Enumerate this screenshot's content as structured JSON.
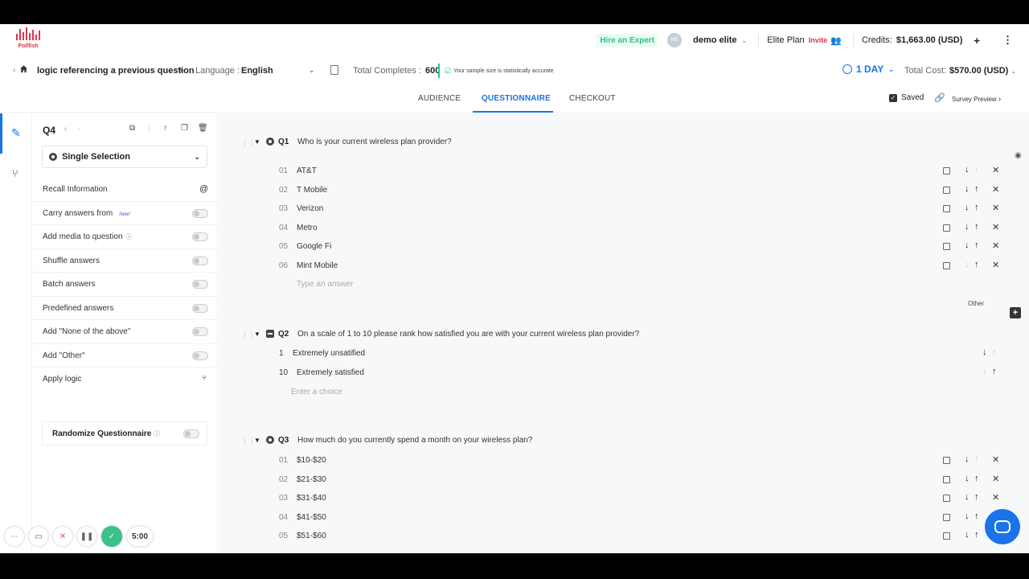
{
  "brand": {
    "name": "Pollfish",
    "color": "#e0344a"
  },
  "topbar": {
    "hire_expert": "Hire an Expert",
    "avatar_initials": "ME",
    "user_name": "demo elite",
    "plan": "Elite Plan",
    "invite": "Invite",
    "credits_label": "Credits:",
    "credits_value": "$1,663.00 (USD)",
    "plus": "+",
    "more": "⋮"
  },
  "survey_bar": {
    "title": "logic referencing a previous question",
    "language_label": "Language :",
    "language_value": "English",
    "total_completes_label": "Total Completes :",
    "total_completes_value": "600",
    "sample_note": "Your sample size is statistically accurate",
    "duration": "1 DAY",
    "total_cost_label": "Total Cost:",
    "total_cost_value": "$570.00 (USD)"
  },
  "tabs": [
    "AUDIENCE",
    "QUESTIONNAIRE",
    "CHECKOUT"
  ],
  "active_tab": "QUESTIONNAIRE",
  "saved_label": "Saved",
  "survey_preview": "Survey Preview",
  "panel": {
    "question_id": "Q4",
    "question_type": "Single Selection",
    "recall": "Recall Information",
    "carry_answers": "Carry answers from",
    "new_badge": "New!",
    "add_media": "Add media to question",
    "shuffle": "Shuffle answers",
    "batch": "Batch answers",
    "predefined": "Predefined answers",
    "none_above": "Add \"None of the above\"",
    "add_other": "Add \"Other\"",
    "apply_logic": "Apply logic",
    "randomize": "Randomize Questionnaire"
  },
  "questions": [
    {
      "number": "Q1",
      "text": "Who is your current wireless plan provider?",
      "answers": [
        {
          "num": "01",
          "text": "AT&T"
        },
        {
          "num": "02",
          "text": "T Mobile"
        },
        {
          "num": "03",
          "text": "Verizon"
        },
        {
          "num": "04",
          "text": "Metro"
        },
        {
          "num": "05",
          "text": "Google Fi"
        },
        {
          "num": "06",
          "text": "Mint Mobile"
        }
      ],
      "placeholder": "Type an answer",
      "other_label": "Other"
    },
    {
      "number": "Q2",
      "text": "On a scale of 1 to 10 please rank how satisfied you are with your current wireless plan provider?",
      "answers": [
        {
          "num": "1",
          "text": "Extremely unsatified"
        },
        {
          "num": "10",
          "text": "Extremely satisfied"
        }
      ],
      "placeholder": "Enter a choice"
    },
    {
      "number": "Q3",
      "text": "How much do you currently spend a month on your wireless plan?",
      "answers": [
        {
          "num": "01",
          "text": "$10-$20"
        },
        {
          "num": "02",
          "text": "$21-$30"
        },
        {
          "num": "03",
          "text": "$31-$40"
        },
        {
          "num": "04",
          "text": "$41-$50"
        },
        {
          "num": "05",
          "text": "$51-$60"
        }
      ]
    }
  ],
  "recorder": {
    "timer": "5:00"
  },
  "accent_color": "#1a73e8",
  "success_color": "#2fc28a"
}
